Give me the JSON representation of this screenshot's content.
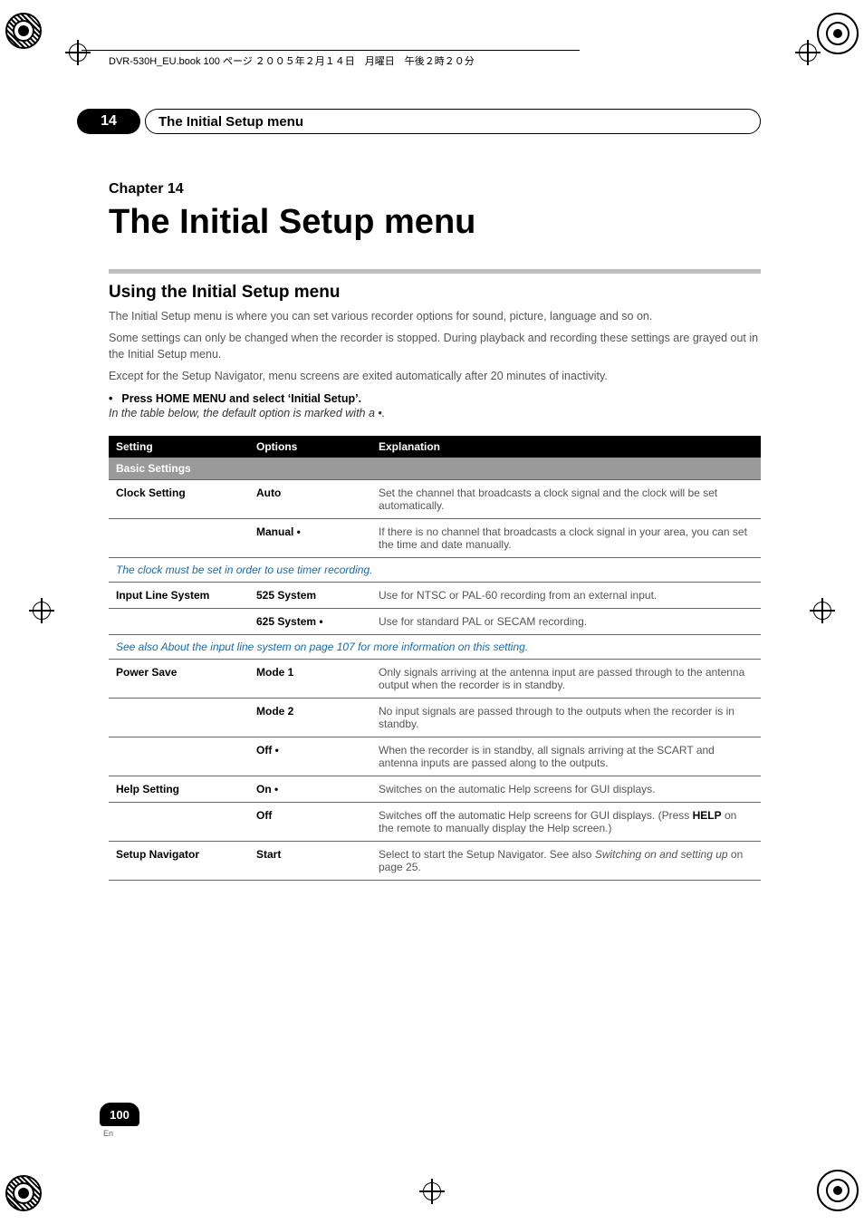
{
  "print_meta_line": "DVR-530H_EU.book  100 ページ  ２００５年２月１４日　月曜日　午後２時２０分",
  "chapter_number_badge": "14",
  "chapter_bar_title": "The Initial Setup menu",
  "chapter_label": "Chapter 14",
  "main_title": "The Initial Setup menu",
  "section_heading": "Using the Initial Setup menu",
  "intro_p1": "The Initial Setup menu is where you can set various recorder options for sound, picture, language and so on.",
  "intro_p2": "Some settings can only be changed when the recorder is stopped. During playback and recording these settings are grayed out in the Initial Setup menu.",
  "intro_p3": "Except for the Setup Navigator, menu screens are exited automatically after 20 minutes of inactivity.",
  "bullet_text": "Press HOME MENU and select ‘Initial Setup’.",
  "italic_note": "In the table below, the default option is marked with a •.",
  "table": {
    "headers": {
      "setting": "Setting",
      "options": "Options",
      "explanation": "Explanation"
    },
    "subhead": "Basic Settings",
    "rows": [
      {
        "setting": "Clock Setting",
        "option": "Auto",
        "expl": "Set the channel that broadcasts a clock signal and the clock will be set automatically."
      },
      {
        "setting": "",
        "option": "Manual •",
        "expl": "If there is no channel that broadcasts a clock signal in your area, you can set the time and date manually."
      }
    ],
    "note1": "The clock must be set in order to use timer recording.",
    "rows2": [
      {
        "setting": "Input Line System",
        "option": "525 System",
        "expl": "Use for NTSC or PAL-60 recording from an external input."
      },
      {
        "setting": "",
        "option": "625 System •",
        "expl": "Use for standard PAL or SECAM recording."
      }
    ],
    "note2": "See also About the input line system on page 107 for more information on this setting.",
    "rows3": [
      {
        "setting": "Power Save",
        "option": "Mode 1",
        "expl": "Only signals arriving at the antenna input are passed through to the antenna output when the recorder is in standby."
      },
      {
        "setting": "",
        "option": "Mode 2",
        "expl": "No input signals are passed through to the outputs when the recorder is in standby."
      },
      {
        "setting": "",
        "option": "Off •",
        "expl": "When the recorder is in standby, all signals arriving at the SCART and antenna inputs are passed along to the outputs."
      },
      {
        "setting": "Help Setting",
        "option": "On •",
        "expl": "Switches on the automatic Help screens for GUI displays."
      },
      {
        "setting": "",
        "option": "Off",
        "expl_pre": "Switches off the automatic Help screens for GUI displays. (Press ",
        "expl_bold": "HELP",
        "expl_post": " on the remote to manually display the Help screen.)"
      },
      {
        "setting": "Setup Navigator",
        "option": "Start",
        "expl_pre": "Select to start the Setup Navigator. See also ",
        "expl_italic": "Switching on and setting up",
        "expl_post": " on page 25."
      }
    ]
  },
  "footer": {
    "page_number": "100",
    "lang": "En"
  }
}
